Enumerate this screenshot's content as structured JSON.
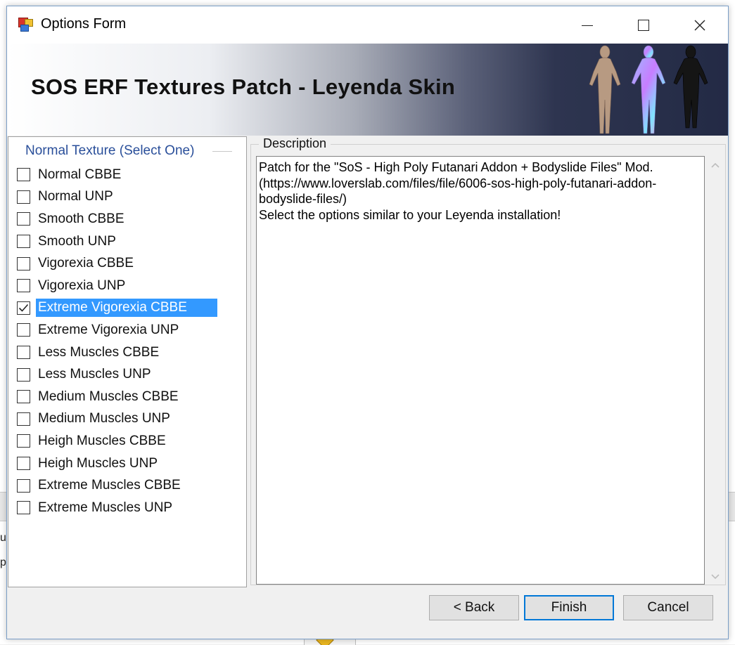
{
  "window": {
    "title": "Options Form"
  },
  "banner": {
    "title": "SOS ERF Textures Patch - Leyenda Skin"
  },
  "options_group": {
    "label": "Normal Texture (Select One)",
    "items": [
      {
        "label": "Normal CBBE",
        "checked": false,
        "selected": false
      },
      {
        "label": "Normal UNP",
        "checked": false,
        "selected": false
      },
      {
        "label": "Smooth CBBE",
        "checked": false,
        "selected": false
      },
      {
        "label": "Smooth UNP",
        "checked": false,
        "selected": false
      },
      {
        "label": "Vigorexia CBBE",
        "checked": false,
        "selected": false
      },
      {
        "label": "Vigorexia UNP",
        "checked": false,
        "selected": false
      },
      {
        "label": "Extreme Vigorexia CBBE",
        "checked": true,
        "selected": true
      },
      {
        "label": "Extreme Vigorexia UNP",
        "checked": false,
        "selected": false
      },
      {
        "label": "Less Muscles CBBE",
        "checked": false,
        "selected": false
      },
      {
        "label": "Less Muscles UNP",
        "checked": false,
        "selected": false
      },
      {
        "label": "Medium Muscles CBBE",
        "checked": false,
        "selected": false
      },
      {
        "label": "Medium Muscles UNP",
        "checked": false,
        "selected": false
      },
      {
        "label": "Heigh Muscles CBBE",
        "checked": false,
        "selected": false
      },
      {
        "label": "Heigh Muscles UNP",
        "checked": false,
        "selected": false
      },
      {
        "label": "Extreme Muscles CBBE",
        "checked": false,
        "selected": false
      },
      {
        "label": "Extreme Muscles UNP",
        "checked": false,
        "selected": false
      }
    ]
  },
  "description": {
    "label": "Description",
    "text": "Patch for the \"SoS - High Poly Futanari Addon + Bodyslide Files\" Mod.\n(https://www.loverslab.com/files/file/6006-sos-high-poly-futanari-addon-\nbodyslide-files/)\nSelect the options similar to your Leyenda installation!"
  },
  "buttons": {
    "back": "< Back",
    "finish": "Finish",
    "cancel": "Cancel"
  },
  "background": {
    "fragment_1": "u",
    "fragment_2": "p"
  }
}
